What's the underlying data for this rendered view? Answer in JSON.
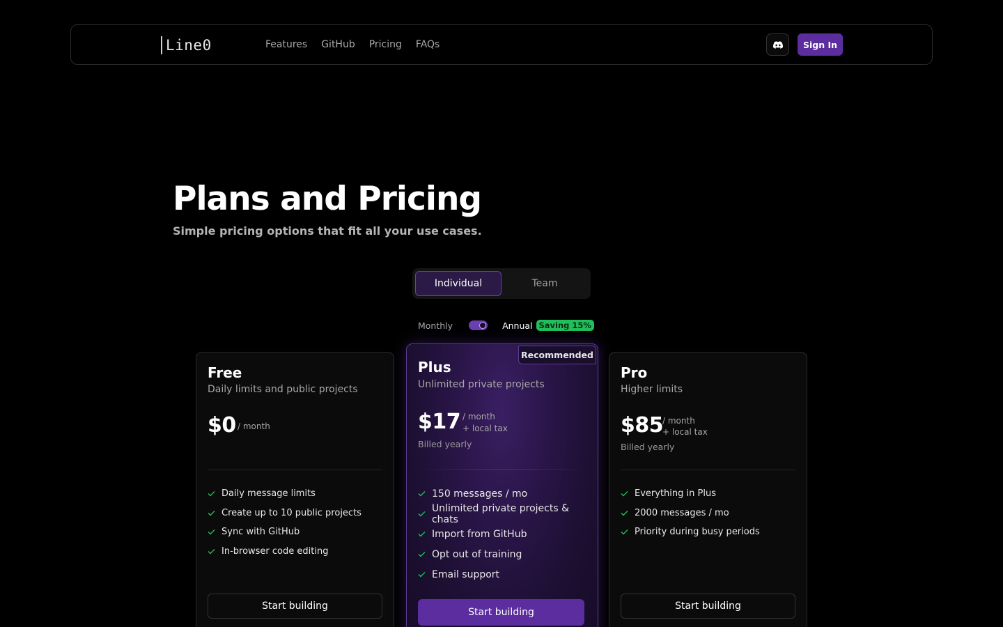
{
  "nav": {
    "logo": "Line0",
    "links": [
      "Features",
      "GitHub",
      "Pricing",
      "FAQs"
    ],
    "sign_in": "Sign In"
  },
  "hero": {
    "title": "Plans and Pricing",
    "subtitle": "Simple pricing options that fit all your use cases."
  },
  "plan_tabs": [
    "Individual",
    "Team"
  ],
  "billing": {
    "monthly": "Monthly",
    "annual": "Annual",
    "saving": "Saving 15%",
    "annual_selected": true
  },
  "plans": [
    {
      "name": "Free",
      "description": "Daily limits and public projects",
      "price": "$0",
      "unit": "/ month",
      "tax": "",
      "billed": "",
      "features": [
        "Daily message limits",
        "Create up to 10 public projects",
        "Sync with GitHub",
        "In-browser code editing"
      ],
      "cta": "Start building"
    },
    {
      "name": "Plus",
      "badge": "Recommended",
      "description": "Unlimited private projects",
      "price": "$17",
      "unit": "/ month",
      "tax": "+ local tax",
      "billed": "Billed yearly",
      "features": [
        "150 messages / mo",
        "Unlimited private projects & chats",
        "Import from GitHub",
        "Opt out of training",
        "Email support"
      ],
      "cta": "Start building"
    },
    {
      "name": "Pro",
      "description": "Higher limits",
      "price": "$85",
      "unit": "/ month",
      "tax": "+ local tax",
      "billed": "Billed yearly",
      "features": [
        "Everything in Plus",
        "2000 messages / mo",
        "Priority during busy periods"
      ],
      "cta": "Start building"
    }
  ],
  "colors": {
    "accent": "#5b2d9e",
    "check": "#1fbf5b",
    "saving_badge": "#1fbf5b"
  }
}
